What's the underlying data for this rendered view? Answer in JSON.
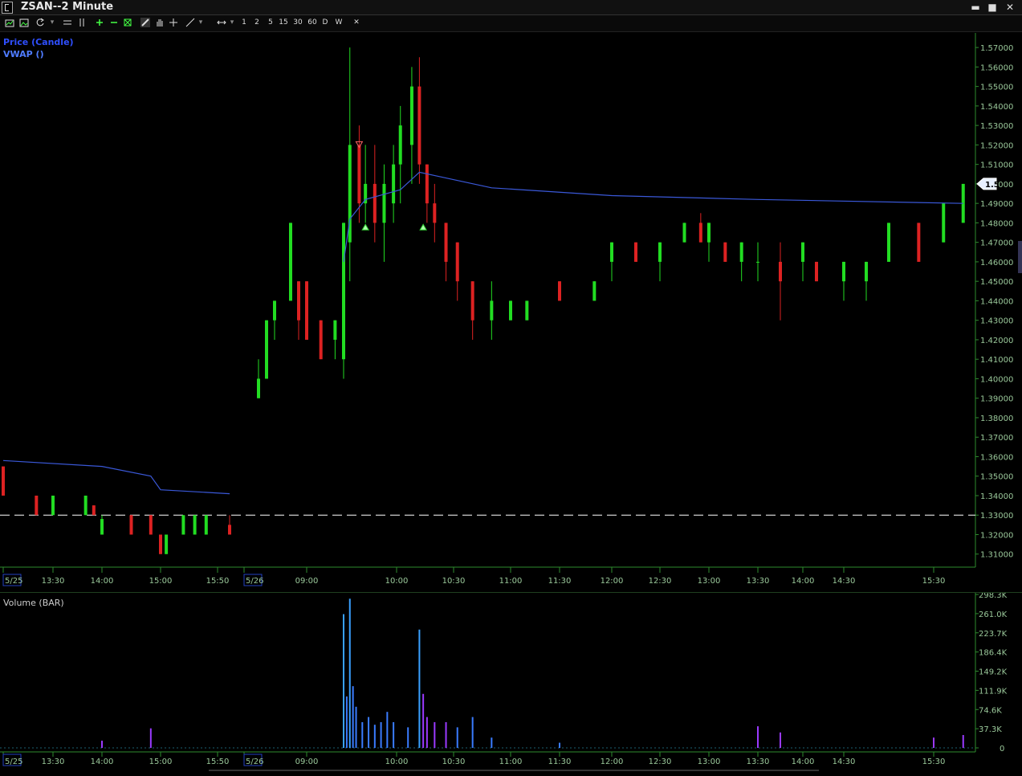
{
  "window": {
    "title": "ZSAN--2 Minute",
    "controls": [
      "minimize",
      "maximize",
      "close"
    ]
  },
  "toolbar": {
    "icons": [
      "chart-icon",
      "image-icon",
      "refresh-icon",
      "lines-icon",
      "bars-icon",
      "zoom-in-icon",
      "zoom-out-icon",
      "fit-icon",
      "draw-icon",
      "pan-icon",
      "crosshair-icon",
      "trendline-icon",
      "range-icon"
    ],
    "intervals": [
      "1",
      "2",
      "5",
      "15",
      "30",
      "60",
      "D",
      "W"
    ],
    "close_label": "✕"
  },
  "price_pane": {
    "legend": [
      "Price (Candle)",
      "VWAP ()"
    ],
    "current_price_tag": "1.5",
    "colors": {
      "up": "#22dd22",
      "down": "#dd2222",
      "vwap": "#3a58d8",
      "axis": "#2e8b2e",
      "label": "#9ac89a",
      "dashed": "#ffffff"
    }
  },
  "volume_pane": {
    "legend": "Volume (BAR)"
  },
  "chart_data": [
    {
      "type": "candlestick",
      "title": "Price (Candle)",
      "overlay": "VWAP ()",
      "ylim": [
        1.3,
        1.575
      ],
      "yticks": [
        "1.57000",
        "1.56000",
        "1.55000",
        "1.54000",
        "1.53000",
        "1.52000",
        "1.51000",
        "1.50000",
        "1.49000",
        "1.48000",
        "1.47000",
        "1.46000",
        "1.45000",
        "1.44000",
        "1.43000",
        "1.42000",
        "1.41000",
        "1.40000",
        "1.39000",
        "1.38000",
        "1.37000",
        "1.36000",
        "1.35000",
        "1.34000",
        "1.33000",
        "1.32000",
        "1.31000"
      ],
      "xticks": [
        "5/25",
        "13:30",
        "14:00",
        "15:00",
        "15:50",
        "5/26",
        "09:00",
        "10:00",
        "10:30",
        "11:00",
        "11:30",
        "12:00",
        "12:30",
        "13:00",
        "13:30",
        "14:00",
        "14:30",
        "15:30"
      ],
      "reference_line": 1.33,
      "last_price": 1.5,
      "candles": [
        {
          "t": "5/25 13:00",
          "o": 1.355,
          "h": 1.355,
          "l": 1.34,
          "c": 1.34
        },
        {
          "t": "5/25 13:20",
          "o": 1.34,
          "h": 1.34,
          "l": 1.33,
          "c": 1.33
        },
        {
          "t": "5/25 13:30",
          "o": 1.33,
          "h": 1.34,
          "l": 1.33,
          "c": 1.34
        },
        {
          "t": "5/25 13:50",
          "o": 1.33,
          "h": 1.34,
          "l": 1.33,
          "c": 1.34
        },
        {
          "t": "5/25 13:55",
          "o": 1.335,
          "h": 1.335,
          "l": 1.33,
          "c": 1.33
        },
        {
          "t": "5/25 14:00",
          "o": 1.32,
          "h": 1.33,
          "l": 1.32,
          "c": 1.328
        },
        {
          "t": "5/25 14:30",
          "o": 1.33,
          "h": 1.33,
          "l": 1.32,
          "c": 1.32
        },
        {
          "t": "5/25 14:50",
          "o": 1.33,
          "h": 1.33,
          "l": 1.32,
          "c": 1.32
        },
        {
          "t": "5/25 15:00",
          "o": 1.32,
          "h": 1.32,
          "l": 1.31,
          "c": 1.31
        },
        {
          "t": "5/25 15:05",
          "o": 1.31,
          "h": 1.32,
          "l": 1.31,
          "c": 1.32
        },
        {
          "t": "5/25 15:20",
          "o": 1.32,
          "h": 1.33,
          "l": 1.32,
          "c": 1.33
        },
        {
          "t": "5/25 15:30",
          "o": 1.32,
          "h": 1.33,
          "l": 1.32,
          "c": 1.33
        },
        {
          "t": "5/25 15:40",
          "o": 1.32,
          "h": 1.33,
          "l": 1.32,
          "c": 1.33
        },
        {
          "t": "5/25 15:55",
          "o": 1.325,
          "h": 1.33,
          "l": 1.32,
          "c": 1.32
        },
        {
          "t": "5/26 08:30",
          "o": 1.39,
          "h": 1.41,
          "l": 1.39,
          "c": 1.4
        },
        {
          "t": "5/26 08:35",
          "o": 1.4,
          "h": 1.43,
          "l": 1.4,
          "c": 1.43
        },
        {
          "t": "5/26 08:40",
          "o": 1.43,
          "h": 1.44,
          "l": 1.42,
          "c": 1.44
        },
        {
          "t": "5/26 08:50",
          "o": 1.44,
          "h": 1.48,
          "l": 1.44,
          "c": 1.48
        },
        {
          "t": "5/26 08:55",
          "o": 1.45,
          "h": 1.45,
          "l": 1.42,
          "c": 1.43
        },
        {
          "t": "5/26 09:00",
          "o": 1.45,
          "h": 1.45,
          "l": 1.42,
          "c": 1.42
        },
        {
          "t": "5/26 09:10",
          "o": 1.43,
          "h": 1.43,
          "l": 1.41,
          "c": 1.41
        },
        {
          "t": "5/26 09:20",
          "o": 1.42,
          "h": 1.43,
          "l": 1.41,
          "c": 1.43
        },
        {
          "t": "5/26 09:26",
          "o": 1.41,
          "h": 1.48,
          "l": 1.4,
          "c": 1.48
        },
        {
          "t": "5/26 09:30",
          "o": 1.47,
          "h": 1.57,
          "l": 1.45,
          "c": 1.52
        },
        {
          "t": "5/26 09:36",
          "o": 1.52,
          "h": 1.53,
          "l": 1.48,
          "c": 1.49
        },
        {
          "t": "5/26 09:40",
          "o": 1.49,
          "h": 1.52,
          "l": 1.48,
          "c": 1.5
        },
        {
          "t": "5/26 09:46",
          "o": 1.5,
          "h": 1.52,
          "l": 1.47,
          "c": 1.48
        },
        {
          "t": "5/26 09:52",
          "o": 1.48,
          "h": 1.51,
          "l": 1.46,
          "c": 1.5
        },
        {
          "t": "5/26 09:58",
          "o": 1.49,
          "h": 1.52,
          "l": 1.48,
          "c": 1.51
        },
        {
          "t": "5/26 10:02",
          "o": 1.51,
          "h": 1.54,
          "l": 1.49,
          "c": 1.53
        },
        {
          "t": "5/26 10:08",
          "o": 1.52,
          "h": 1.56,
          "l": 1.5,
          "c": 1.55
        },
        {
          "t": "5/26 10:12",
          "o": 1.55,
          "h": 1.565,
          "l": 1.5,
          "c": 1.51
        },
        {
          "t": "5/26 10:16",
          "o": 1.51,
          "h": 1.51,
          "l": 1.48,
          "c": 1.49
        },
        {
          "t": "5/26 10:20",
          "o": 1.49,
          "h": 1.5,
          "l": 1.47,
          "c": 1.48
        },
        {
          "t": "5/26 10:26",
          "o": 1.48,
          "h": 1.48,
          "l": 1.45,
          "c": 1.46
        },
        {
          "t": "5/26 10:32",
          "o": 1.47,
          "h": 1.47,
          "l": 1.44,
          "c": 1.45
        },
        {
          "t": "5/26 10:40",
          "o": 1.45,
          "h": 1.45,
          "l": 1.42,
          "c": 1.43
        },
        {
          "t": "5/26 10:50",
          "o": 1.43,
          "h": 1.45,
          "l": 1.42,
          "c": 1.44
        },
        {
          "t": "5/26 11:00",
          "o": 1.43,
          "h": 1.44,
          "l": 1.43,
          "c": 1.44
        },
        {
          "t": "5/26 11:10",
          "o": 1.43,
          "h": 1.44,
          "l": 1.43,
          "c": 1.44
        },
        {
          "t": "5/26 11:30",
          "o": 1.45,
          "h": 1.45,
          "l": 1.44,
          "c": 1.44
        },
        {
          "t": "5/26 11:50",
          "o": 1.44,
          "h": 1.45,
          "l": 1.44,
          "c": 1.45
        },
        {
          "t": "5/26 12:00",
          "o": 1.46,
          "h": 1.47,
          "l": 1.45,
          "c": 1.47
        },
        {
          "t": "5/26 12:15",
          "o": 1.47,
          "h": 1.47,
          "l": 1.46,
          "c": 1.46
        },
        {
          "t": "5/26 12:30",
          "o": 1.46,
          "h": 1.47,
          "l": 1.45,
          "c": 1.47
        },
        {
          "t": "5/26 12:45",
          "o": 1.47,
          "h": 1.48,
          "l": 1.47,
          "c": 1.48
        },
        {
          "t": "5/26 12:55",
          "o": 1.48,
          "h": 1.485,
          "l": 1.47,
          "c": 1.47
        },
        {
          "t": "5/26 13:00",
          "o": 1.47,
          "h": 1.48,
          "l": 1.46,
          "c": 1.48
        },
        {
          "t": "5/26 13:10",
          "o": 1.47,
          "h": 1.47,
          "l": 1.46,
          "c": 1.46
        },
        {
          "t": "5/26 13:20",
          "o": 1.46,
          "h": 1.47,
          "l": 1.45,
          "c": 1.47
        },
        {
          "t": "5/26 13:30",
          "o": 1.46,
          "h": 1.47,
          "l": 1.45,
          "c": 1.46
        },
        {
          "t": "5/26 13:45",
          "o": 1.46,
          "h": 1.47,
          "l": 1.43,
          "c": 1.45
        },
        {
          "t": "5/26 14:00",
          "o": 1.46,
          "h": 1.47,
          "l": 1.45,
          "c": 1.47
        },
        {
          "t": "5/26 14:10",
          "o": 1.46,
          "h": 1.46,
          "l": 1.45,
          "c": 1.45
        },
        {
          "t": "5/26 14:30",
          "o": 1.45,
          "h": 1.46,
          "l": 1.44,
          "c": 1.46
        },
        {
          "t": "5/26 14:45",
          "o": 1.45,
          "h": 1.46,
          "l": 1.44,
          "c": 1.46
        },
        {
          "t": "5/26 15:00",
          "o": 1.46,
          "h": 1.48,
          "l": 1.46,
          "c": 1.48
        },
        {
          "t": "5/26 15:20",
          "o": 1.48,
          "h": 1.48,
          "l": 1.46,
          "c": 1.46
        },
        {
          "t": "5/26 15:35",
          "o": 1.47,
          "h": 1.49,
          "l": 1.47,
          "c": 1.49
        },
        {
          "t": "5/26 15:45",
          "o": 1.48,
          "h": 1.5,
          "l": 1.48,
          "c": 1.5
        }
      ],
      "vwap": [
        {
          "t": "5/25 13:00",
          "v": 1.358
        },
        {
          "t": "5/25 14:00",
          "v": 1.355
        },
        {
          "t": "5/25 14:50",
          "v": 1.35
        },
        {
          "t": "5/25 15:00",
          "v": 1.343
        },
        {
          "t": "5/25 15:55",
          "v": 1.341
        },
        {
          "t": "5/26 09:26",
          "v": 1.46
        },
        {
          "t": "5/26 09:30",
          "v": 1.482
        },
        {
          "t": "5/26 09:40",
          "v": 1.492
        },
        {
          "t": "5/26 10:02",
          "v": 1.497
        },
        {
          "t": "5/26 10:12",
          "v": 1.506
        },
        {
          "t": "5/26 10:26",
          "v": 1.503
        },
        {
          "t": "5/26 10:50",
          "v": 1.498
        },
        {
          "t": "5/26 12:00",
          "v": 1.494
        },
        {
          "t": "5/26 13:30",
          "v": 1.492
        },
        {
          "t": "5/26 15:45",
          "v": 1.49
        }
      ],
      "markers": [
        {
          "t": "5/26 09:36",
          "type": "down-arrow",
          "y": 1.52
        },
        {
          "t": "5/26 09:40",
          "type": "up-arrow",
          "y": 1.478
        },
        {
          "t": "5/26 10:14",
          "type": "up-arrow",
          "y": 1.478
        }
      ]
    },
    {
      "type": "bar",
      "title": "Volume (BAR)",
      "ylim": [
        0,
        298300
      ],
      "yticks": [
        "298.3K",
        "261.0K",
        "223.7K",
        "186.4K",
        "149.2K",
        "111.9K",
        "74.6K",
        "37.3K",
        "0"
      ],
      "xticks": [
        "5/25",
        "13:30",
        "14:00",
        "15:00",
        "15:50",
        "5/26",
        "09:00",
        "10:00",
        "10:30",
        "11:00",
        "11:30",
        "12:00",
        "12:30",
        "13:00",
        "13:30",
        "14:00",
        "14:30",
        "15:30"
      ],
      "bars": [
        {
          "t": "5/25 14:00",
          "v": 14000
        },
        {
          "t": "5/25 14:50",
          "v": 38000
        },
        {
          "t": "5/26 09:26",
          "v": 260000
        },
        {
          "t": "5/26 09:28",
          "v": 100000
        },
        {
          "t": "5/26 09:30",
          "v": 290000
        },
        {
          "t": "5/26 09:32",
          "v": 120000
        },
        {
          "t": "5/26 09:34",
          "v": 80000
        },
        {
          "t": "5/26 09:38",
          "v": 50000
        },
        {
          "t": "5/26 09:42",
          "v": 60000
        },
        {
          "t": "5/26 09:46",
          "v": 45000
        },
        {
          "t": "5/26 09:50",
          "v": 50000
        },
        {
          "t": "5/26 09:54",
          "v": 70000
        },
        {
          "t": "5/26 09:58",
          "v": 50000
        },
        {
          "t": "5/26 10:06",
          "v": 40000
        },
        {
          "t": "5/26 10:12",
          "v": 230000
        },
        {
          "t": "5/26 10:14",
          "v": 105000
        },
        {
          "t": "5/26 10:16",
          "v": 60000
        },
        {
          "t": "5/26 10:20",
          "v": 50000
        },
        {
          "t": "5/26 10:26",
          "v": 50000
        },
        {
          "t": "5/26 10:32",
          "v": 40000
        },
        {
          "t": "5/26 10:40",
          "v": 60000
        },
        {
          "t": "5/26 10:50",
          "v": 20000
        },
        {
          "t": "5/26 11:30",
          "v": 10000
        },
        {
          "t": "5/26 13:30",
          "v": 42000
        },
        {
          "t": "5/26 13:45",
          "v": 30000
        },
        {
          "t": "5/26 15:30",
          "v": 20000
        },
        {
          "t": "5/26 15:45",
          "v": 25000
        }
      ]
    }
  ]
}
